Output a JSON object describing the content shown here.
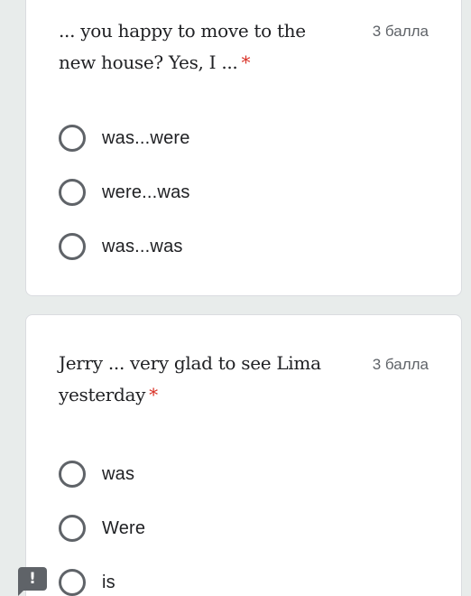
{
  "questions": [
    {
      "text": "... you happy to move to the new house? Yes, I ...",
      "required_mark": "*",
      "points": "3 балла",
      "options": [
        {
          "label": "was...were"
        },
        {
          "label": "were...was"
        },
        {
          "label": "was...was"
        }
      ]
    },
    {
      "text": "Jerry ... very glad to see Lima yesterday",
      "required_mark": "*",
      "points": "3 балла",
      "options": [
        {
          "label": "was"
        },
        {
          "label": "Were"
        },
        {
          "label": "is"
        }
      ]
    }
  ],
  "report_button": {
    "icon": "exclamation-icon",
    "glyph": "!"
  },
  "colors": {
    "background": "#e8eceb",
    "card": "#ffffff",
    "required": "#d93025",
    "radio_border": "#5f6368",
    "points_text": "#5f6368"
  }
}
